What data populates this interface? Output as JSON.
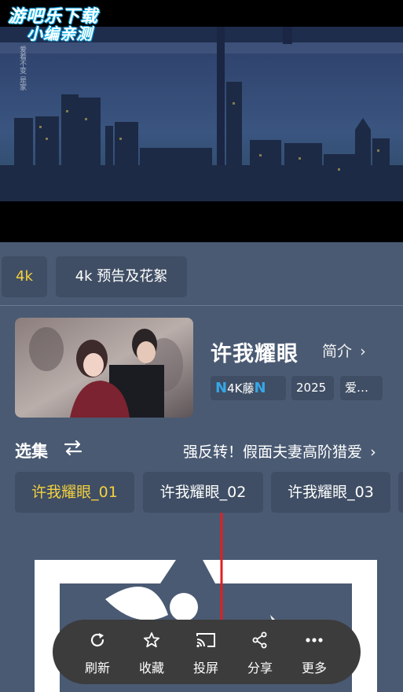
{
  "watermark": {
    "line1": "游吧乐下载",
    "line2": "小编亲测"
  },
  "video": {
    "overlay_text": "爱着不变 是家"
  },
  "sources": [
    {
      "label": "4k",
      "active": true
    },
    {
      "label": "4k 预告及花絮",
      "active": false
    }
  ],
  "show": {
    "title": "许我耀眼",
    "intro_label": "简介",
    "chips": [
      "4K藤",
      "2025",
      "爱…"
    ],
    "chip_logo": "N"
  },
  "episodes": {
    "label": "选集",
    "title": "强反转！假面夫妻高阶猎爱",
    "items": [
      {
        "label": "许我耀眼_01",
        "active": true
      },
      {
        "label": "许我耀眼_02",
        "active": false
      },
      {
        "label": "许我耀眼_03",
        "active": false
      }
    ]
  },
  "toolbar": {
    "items": [
      {
        "label": "刷新",
        "icon": "refresh-icon"
      },
      {
        "label": "收藏",
        "icon": "star-icon"
      },
      {
        "label": "投屏",
        "icon": "cast-icon"
      },
      {
        "label": "分享",
        "icon": "share-icon"
      },
      {
        "label": "更多",
        "icon": "more-icon"
      }
    ]
  },
  "colors": {
    "background": "#4a5a73",
    "card": "#3f4e64",
    "accent": "#f4d03f",
    "toolbar": "#3c3c3c",
    "arrow": "#e02020"
  }
}
